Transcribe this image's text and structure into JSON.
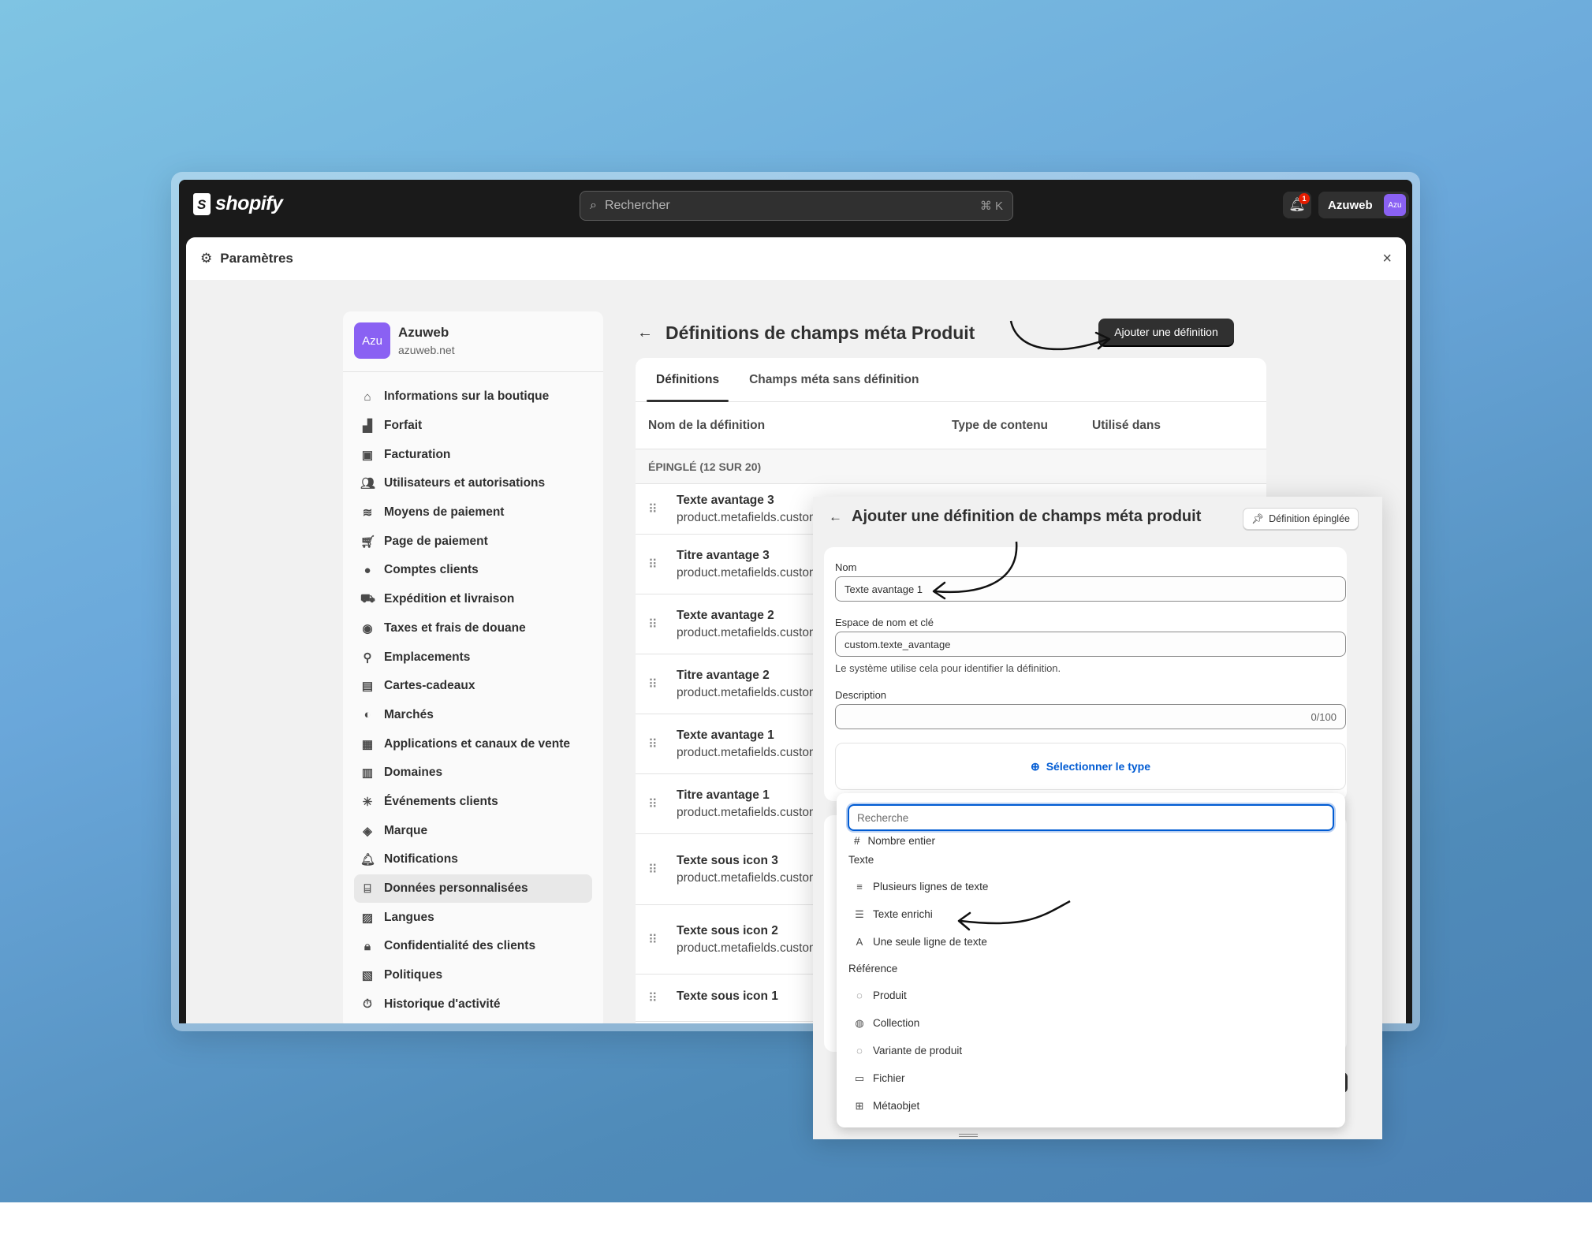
{
  "topbar": {
    "brand": "shopify",
    "search_placeholder": "Rechercher",
    "search_shortcut": "⌘ K",
    "notification_count": "1",
    "store_name": "Azuweb",
    "store_avatar": "Azu"
  },
  "settings": {
    "title": "Paramètres",
    "close": "×"
  },
  "sidebar": {
    "store_avatar": "Azu",
    "store_name": "Azuweb",
    "store_domain": "azuweb.net",
    "items": [
      {
        "label": "Informations sur la boutique",
        "icon": "store-icon"
      },
      {
        "label": "Forfait",
        "icon": "chart-icon"
      },
      {
        "label": "Facturation",
        "icon": "receipt-icon"
      },
      {
        "label": "Utilisateurs et autorisations",
        "icon": "users-icon"
      },
      {
        "label": "Moyens de paiement",
        "icon": "payment-icon"
      },
      {
        "label": "Page de paiement",
        "icon": "cart-icon"
      },
      {
        "label": "Comptes clients",
        "icon": "person-icon"
      },
      {
        "label": "Expédition et livraison",
        "icon": "truck-icon"
      },
      {
        "label": "Taxes et frais de douane",
        "icon": "bag-icon"
      },
      {
        "label": "Emplacements",
        "icon": "location-icon"
      },
      {
        "label": "Cartes-cadeaux",
        "icon": "gift-card-icon"
      },
      {
        "label": "Marchés",
        "icon": "globe-icon"
      },
      {
        "label": "Applications et canaux de vente",
        "icon": "apps-icon"
      },
      {
        "label": "Domaines",
        "icon": "domain-icon"
      },
      {
        "label": "Événements clients",
        "icon": "cursor-icon"
      },
      {
        "label": "Marque",
        "icon": "brand-icon"
      },
      {
        "label": "Notifications",
        "icon": "bell-icon"
      },
      {
        "label": "Données personnalisées",
        "icon": "database-icon",
        "active": true
      },
      {
        "label": "Langues",
        "icon": "language-icon"
      },
      {
        "label": "Confidentialité des clients",
        "icon": "lock-icon"
      },
      {
        "label": "Politiques",
        "icon": "policy-icon"
      },
      {
        "label": "Historique d'activité",
        "icon": "history-icon"
      }
    ]
  },
  "page": {
    "title": "Définitions de champs méta Produit",
    "add_button": "Ajouter une définition",
    "tabs": [
      "Définitions",
      "Champs méta sans définition"
    ],
    "columns": [
      "Nom de la définition",
      "Type de contenu",
      "Utilisé dans"
    ],
    "pinned_label": "ÉPINGLÉ (12 SUR 20)",
    "rows": [
      {
        "name": "Texte avantage 3",
        "key": "product.metafields.custom"
      },
      {
        "name": "Titre avantage 3",
        "key": "product.metafields.custom"
      },
      {
        "name": "Texte avantage 2",
        "key": "product.metafields.custom"
      },
      {
        "name": "Titre avantage 2",
        "key": "product.metafields.custom"
      },
      {
        "name": "Texte avantage 1",
        "key": "product.metafields.custom"
      },
      {
        "name": "Titre avantage 1",
        "key": "product.metafields.custom"
      },
      {
        "name": "Texte sous icon 3",
        "key": "product.metafields.custom"
      },
      {
        "name": "Texte sous icon 2",
        "key": "product.metafields.custom"
      },
      {
        "name": "Texte sous icon 1",
        "key": ""
      }
    ]
  },
  "modal": {
    "title": "Ajouter une définition de champs méta produit",
    "pinned_button": "Définition épinglée",
    "name_label": "Nom",
    "name_value": "Texte avantage 1",
    "namespace_label": "Espace de nom et clé",
    "namespace_value": "custom.texte_avantage",
    "namespace_help": "Le système utilise cela pour identifier la définition.",
    "description_label": "Description",
    "description_counter": "0/100",
    "select_type": "Sélectionner le type"
  },
  "dropdown": {
    "search_placeholder": "Recherche",
    "cut_item": "Nombre entier",
    "groups": [
      {
        "label": "Texte",
        "items": [
          {
            "label": "Plusieurs lignes de texte",
            "icon": "multiline-icon"
          },
          {
            "label": "Texte enrichi",
            "icon": "rich-text-icon"
          },
          {
            "label": "Une seule ligne de texte",
            "icon": "single-line-icon"
          }
        ]
      },
      {
        "label": "Référence",
        "items": [
          {
            "label": "Produit",
            "icon": "product-icon"
          },
          {
            "label": "Collection",
            "icon": "collection-icon"
          },
          {
            "label": "Variante de produit",
            "icon": "variant-icon"
          },
          {
            "label": "Fichier",
            "icon": "file-icon"
          },
          {
            "label": "Métaobjet",
            "icon": "metaobject-icon"
          }
        ]
      }
    ]
  },
  "colors": {
    "accent": "#005bd3",
    "avatar": "#8a61f3",
    "topbar": "#1a1a1a"
  }
}
